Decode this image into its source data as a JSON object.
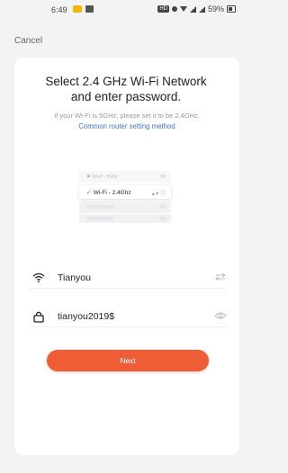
{
  "status_bar": {
    "time": "6:49",
    "hd_badge": "HD",
    "battery": "59%"
  },
  "nav": {
    "cancel_label": "Cancel"
  },
  "header": {
    "title_line1": "Select 2.4 GHz Wi-Fi Network",
    "title_line2": "and enter password.",
    "subtitle": "If your Wi-Fi is 5GHz, please set it to be 2.4GHz.",
    "link_text": "Common router setting method"
  },
  "illustration": {
    "row_5ghz": "Wi-Fi - 5Ghz",
    "row_24ghz": "Wi-Fi - 2.4Ghz"
  },
  "form": {
    "wifi_name": "Tianyou",
    "password": "tianyou2019$"
  },
  "actions": {
    "next_label": "Next"
  },
  "colors": {
    "accent": "#ee5d36",
    "link": "#3f74c9"
  }
}
